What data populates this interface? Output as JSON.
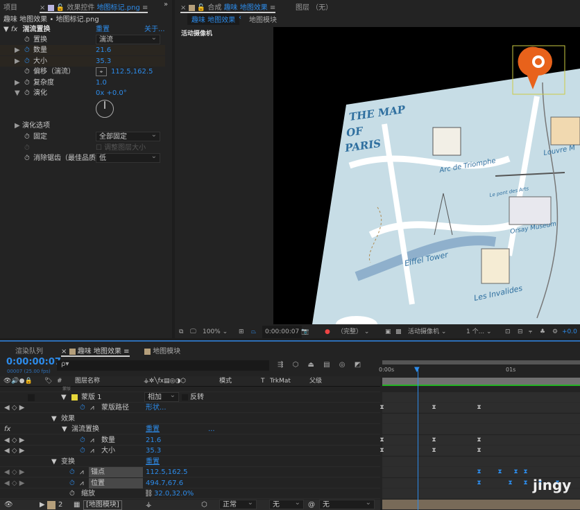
{
  "left_panel": {
    "tab_project": "项目",
    "tab_effects": "效果控件",
    "tab_effects_file": "地图标记.png",
    "breadcrumb_comp": "趣味 地图效果",
    "breadcrumb_sep": "•",
    "breadcrumb_layer": "地图标记.png",
    "effect_name": "湍流置换",
    "reset": "重置",
    "about": "关于...",
    "props": [
      {
        "label": "置换",
        "value": "湍流",
        "type": "dropdown"
      },
      {
        "label": "数量",
        "value": "21.6"
      },
      {
        "label": "大小",
        "value": "35.3"
      },
      {
        "label": "偏移（湍流）",
        "value": "112.5,162.5"
      },
      {
        "label": "复杂度",
        "value": "1.0"
      },
      {
        "label": "演化",
        "value": "0x +0.0°"
      },
      {
        "label": "演化选项",
        "value": ""
      },
      {
        "label": "固定",
        "value": "全部固定",
        "type": "dropdown"
      },
      {
        "label": "",
        "value": "调整图层大小",
        "type": "checkbox"
      },
      {
        "label": "消除锯齿（最佳品质",
        "value": "低",
        "type": "dropdown"
      }
    ]
  },
  "viewer": {
    "tab_comp_prefix": "合成",
    "tab_comp": "趣味 地图效果",
    "tab_layer": "图层 （无）",
    "sub_active": "趣味 地图效果",
    "sub_other": "地图模块",
    "camera_label": "活动摄像机",
    "map_title_lines": [
      "THE MAP",
      "OF",
      "PARIS"
    ],
    "map_labels": [
      "Arc de Triomphe",
      "Louvre M",
      "Le pont des Arts",
      "Orsay Museum",
      "Eiffel Tower",
      "Les Invalides"
    ],
    "toolbar": {
      "zoom": "100%",
      "timecode": "0:00:00:07",
      "resolution": "（完整）",
      "camera": "活动摄像机",
      "views": "1 个...",
      "exposure": "+0.0"
    }
  },
  "timeline": {
    "tab_render": "渲染队列",
    "tab_comp": "趣味 地图效果",
    "tab_module": "地图模块",
    "timecode": "0:00:00:07",
    "fps": "00007 (25.00 fps)",
    "search_placeholder": "ρ▾",
    "headers": {
      "hash": "#",
      "name": "图层名称",
      "mode": "模式",
      "t": "T",
      "trkmat": "TrkMat",
      "parent": "父级"
    },
    "ruler": {
      "start": "0:00s",
      "mark": "01s"
    },
    "rows": {
      "cut": "蒙版",
      "mask": "蒙版 1",
      "mask_mode": "相加",
      "invert": "反转",
      "mask_path": "蒙版路径",
      "mask_path_val": "形状...",
      "effects": "效果",
      "turb": "湍流置换",
      "turb_reset": "重置",
      "turb_more": "...",
      "amount": "数量",
      "amount_val": "21.6",
      "size": "大小",
      "size_val": "35.3",
      "transform": "变换",
      "transform_reset": "重置",
      "anchor": "锚点",
      "anchor_val": "112.5,162.5",
      "position": "位置",
      "position_val": "494.7,67.6",
      "scale": "缩放",
      "scale_val": "32.0,32.0%",
      "layer2_num": "2",
      "layer2_name": "[地图模块]",
      "layer2_mode": "正常",
      "layer2_trkmat": "无",
      "layer2_parent": "无"
    }
  },
  "watermark": "jingy",
  "colors": {
    "accent": "#2d8ceb",
    "mask_swatch": "#e6d63a",
    "layer_swatch": "#b59f7b",
    "map_bg": "#c8dde6",
    "work_bar": "#22b322"
  }
}
